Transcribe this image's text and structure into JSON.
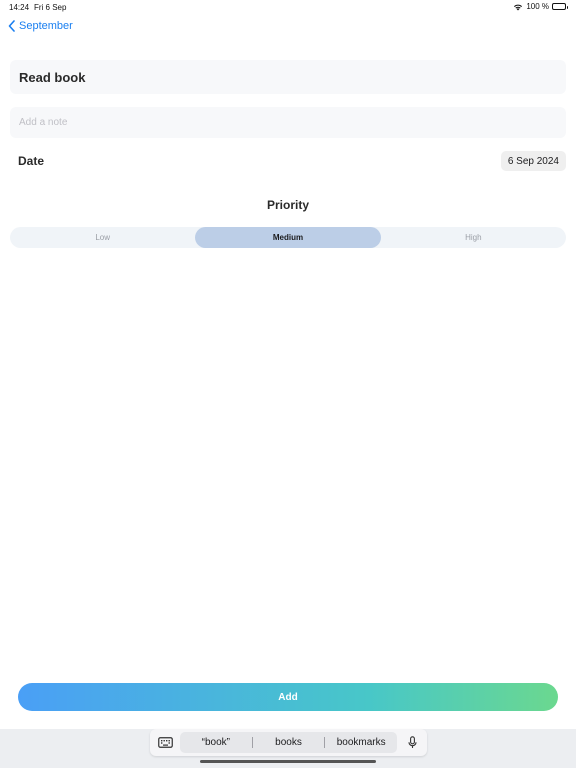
{
  "status_bar": {
    "time": "14:24",
    "date": "Fri 6 Sep",
    "battery": "100 %"
  },
  "nav": {
    "back_label": "September"
  },
  "form": {
    "title_value": "Read book",
    "note_placeholder": "Add a note",
    "date_label": "Date",
    "date_value": "6 Sep 2024",
    "priority_title": "Priority",
    "priority_options": [
      "Low",
      "Medium",
      "High"
    ],
    "priority_selected": "Medium"
  },
  "actions": {
    "add_label": "Add"
  },
  "keyboard": {
    "suggestions": [
      "“book”",
      "books",
      "bookmarks"
    ]
  },
  "icons": {
    "back": "chevron-left-icon",
    "wifi": "wifi-icon",
    "battery": "battery-icon",
    "keyboard": "keyboard-icon",
    "mic": "microphone-icon"
  },
  "colors": {
    "accent": "#1a7ff0",
    "segment_selected": "#bccee7",
    "button_gradient_start": "#4a9ff6",
    "button_gradient_end": "#6bd88f"
  }
}
